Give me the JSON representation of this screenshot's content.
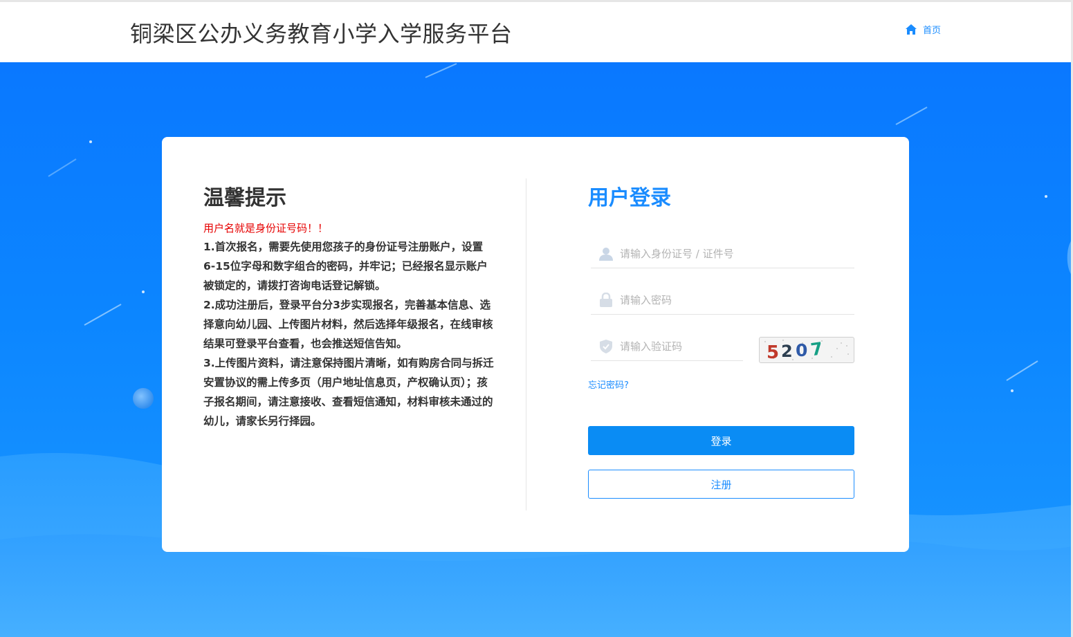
{
  "header": {
    "title": "铜梁区公办义务教育小学入学服务平台",
    "home_label": "首页"
  },
  "notice": {
    "title": "温馨提示",
    "highlight": "用户名就是身份证号码！！",
    "items": [
      "1.首次报名，需要先使用您孩子的身份证号注册账户，设置6-15位字母和数字组合的密码，并牢记；已经报名显示账户被锁定的，请拨打咨询电话登记解锁。",
      "2.成功注册后，登录平台分3步实现报名，完善基本信息、选择意向幼儿园、上传图片材料，然后选择年级报名，在线审核结果可登录平台查看，也会推送短信告知。",
      "3.上传图片资料，请注意保持图片清晰，如有购房合同与拆迁安置协议的需上传多页（用户地址信息页，产权确认页）；孩子报名期间，请注意接收、查看短信通知，材料审核未通过的幼儿，请家长另行择园。"
    ]
  },
  "login": {
    "title": "用户登录",
    "username_placeholder": "请输入身份证号 / 证件号",
    "password_placeholder": "请输入密码",
    "captcha_placeholder": "请输入验证码",
    "captcha_text": "5207",
    "forgot_label": "忘记密码?",
    "login_button": "登录",
    "register_button": "注册"
  },
  "icons": {
    "home": "home-icon",
    "user": "user-icon",
    "lock": "lock-icon",
    "shield": "shield-icon"
  },
  "colors": {
    "accent": "#1a8cff",
    "button": "#0a8cf4",
    "hero": "#0c86ff",
    "warning": "#e60000"
  }
}
